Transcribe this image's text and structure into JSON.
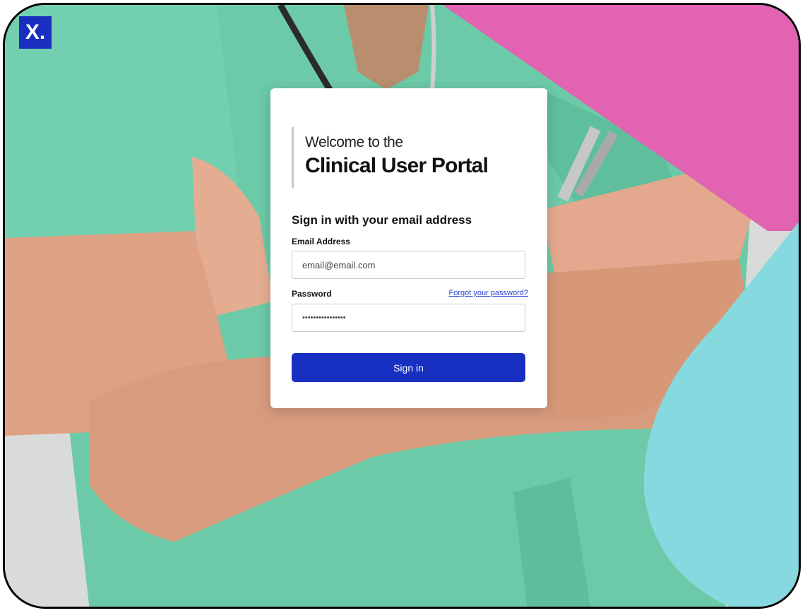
{
  "brand": {
    "logo_text": "X.",
    "logo_color": "#1a2fc0"
  },
  "login": {
    "welcome_line": "Welcome to the",
    "portal_title": "Clinical User Portal",
    "subtitle": "Sign in with your email address",
    "email_label": "Email Address",
    "email_value": "email@email.com",
    "password_label": "Password",
    "password_value": "••••••••••••••••",
    "forgot_link": "Forgot your password?",
    "signin_button": "Sign in"
  },
  "colors": {
    "accent_blue": "#1730c2",
    "accent_pink": "#e163b1",
    "accent_teal": "#86dadf",
    "scrubs_green": "#6cc9a6"
  }
}
